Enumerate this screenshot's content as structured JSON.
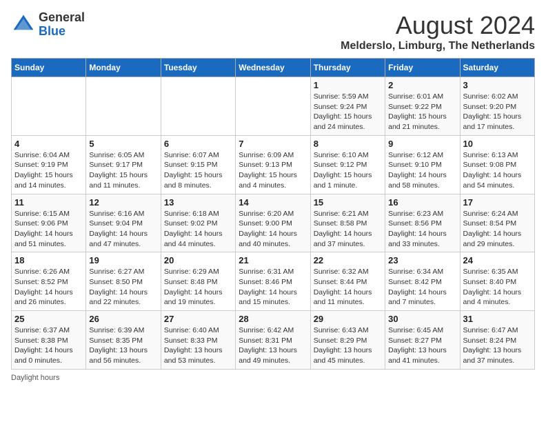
{
  "header": {
    "logo_general": "General",
    "logo_blue": "Blue",
    "main_title": "August 2024",
    "subtitle": "Melderslo, Limburg, The Netherlands"
  },
  "weekdays": [
    "Sunday",
    "Monday",
    "Tuesday",
    "Wednesday",
    "Thursday",
    "Friday",
    "Saturday"
  ],
  "footer": {
    "daylight_label": "Daylight hours"
  },
  "weeks": [
    [
      {
        "day": "",
        "info": ""
      },
      {
        "day": "",
        "info": ""
      },
      {
        "day": "",
        "info": ""
      },
      {
        "day": "",
        "info": ""
      },
      {
        "day": "1",
        "info": "Sunrise: 5:59 AM\nSunset: 9:24 PM\nDaylight: 15 hours\nand 24 minutes."
      },
      {
        "day": "2",
        "info": "Sunrise: 6:01 AM\nSunset: 9:22 PM\nDaylight: 15 hours\nand 21 minutes."
      },
      {
        "day": "3",
        "info": "Sunrise: 6:02 AM\nSunset: 9:20 PM\nDaylight: 15 hours\nand 17 minutes."
      }
    ],
    [
      {
        "day": "4",
        "info": "Sunrise: 6:04 AM\nSunset: 9:19 PM\nDaylight: 15 hours\nand 14 minutes."
      },
      {
        "day": "5",
        "info": "Sunrise: 6:05 AM\nSunset: 9:17 PM\nDaylight: 15 hours\nand 11 minutes."
      },
      {
        "day": "6",
        "info": "Sunrise: 6:07 AM\nSunset: 9:15 PM\nDaylight: 15 hours\nand 8 minutes."
      },
      {
        "day": "7",
        "info": "Sunrise: 6:09 AM\nSunset: 9:13 PM\nDaylight: 15 hours\nand 4 minutes."
      },
      {
        "day": "8",
        "info": "Sunrise: 6:10 AM\nSunset: 9:12 PM\nDaylight: 15 hours\nand 1 minute."
      },
      {
        "day": "9",
        "info": "Sunrise: 6:12 AM\nSunset: 9:10 PM\nDaylight: 14 hours\nand 58 minutes."
      },
      {
        "day": "10",
        "info": "Sunrise: 6:13 AM\nSunset: 9:08 PM\nDaylight: 14 hours\nand 54 minutes."
      }
    ],
    [
      {
        "day": "11",
        "info": "Sunrise: 6:15 AM\nSunset: 9:06 PM\nDaylight: 14 hours\nand 51 minutes."
      },
      {
        "day": "12",
        "info": "Sunrise: 6:16 AM\nSunset: 9:04 PM\nDaylight: 14 hours\nand 47 minutes."
      },
      {
        "day": "13",
        "info": "Sunrise: 6:18 AM\nSunset: 9:02 PM\nDaylight: 14 hours\nand 44 minutes."
      },
      {
        "day": "14",
        "info": "Sunrise: 6:20 AM\nSunset: 9:00 PM\nDaylight: 14 hours\nand 40 minutes."
      },
      {
        "day": "15",
        "info": "Sunrise: 6:21 AM\nSunset: 8:58 PM\nDaylight: 14 hours\nand 37 minutes."
      },
      {
        "day": "16",
        "info": "Sunrise: 6:23 AM\nSunset: 8:56 PM\nDaylight: 14 hours\nand 33 minutes."
      },
      {
        "day": "17",
        "info": "Sunrise: 6:24 AM\nSunset: 8:54 PM\nDaylight: 14 hours\nand 29 minutes."
      }
    ],
    [
      {
        "day": "18",
        "info": "Sunrise: 6:26 AM\nSunset: 8:52 PM\nDaylight: 14 hours\nand 26 minutes."
      },
      {
        "day": "19",
        "info": "Sunrise: 6:27 AM\nSunset: 8:50 PM\nDaylight: 14 hours\nand 22 minutes."
      },
      {
        "day": "20",
        "info": "Sunrise: 6:29 AM\nSunset: 8:48 PM\nDaylight: 14 hours\nand 19 minutes."
      },
      {
        "day": "21",
        "info": "Sunrise: 6:31 AM\nSunset: 8:46 PM\nDaylight: 14 hours\nand 15 minutes."
      },
      {
        "day": "22",
        "info": "Sunrise: 6:32 AM\nSunset: 8:44 PM\nDaylight: 14 hours\nand 11 minutes."
      },
      {
        "day": "23",
        "info": "Sunrise: 6:34 AM\nSunset: 8:42 PM\nDaylight: 14 hours\nand 7 minutes."
      },
      {
        "day": "24",
        "info": "Sunrise: 6:35 AM\nSunset: 8:40 PM\nDaylight: 14 hours\nand 4 minutes."
      }
    ],
    [
      {
        "day": "25",
        "info": "Sunrise: 6:37 AM\nSunset: 8:38 PM\nDaylight: 14 hours\nand 0 minutes."
      },
      {
        "day": "26",
        "info": "Sunrise: 6:39 AM\nSunset: 8:35 PM\nDaylight: 13 hours\nand 56 minutes."
      },
      {
        "day": "27",
        "info": "Sunrise: 6:40 AM\nSunset: 8:33 PM\nDaylight: 13 hours\nand 53 minutes."
      },
      {
        "day": "28",
        "info": "Sunrise: 6:42 AM\nSunset: 8:31 PM\nDaylight: 13 hours\nand 49 minutes."
      },
      {
        "day": "29",
        "info": "Sunrise: 6:43 AM\nSunset: 8:29 PM\nDaylight: 13 hours\nand 45 minutes."
      },
      {
        "day": "30",
        "info": "Sunrise: 6:45 AM\nSunset: 8:27 PM\nDaylight: 13 hours\nand 41 minutes."
      },
      {
        "day": "31",
        "info": "Sunrise: 6:47 AM\nSunset: 8:24 PM\nDaylight: 13 hours\nand 37 minutes."
      }
    ]
  ]
}
